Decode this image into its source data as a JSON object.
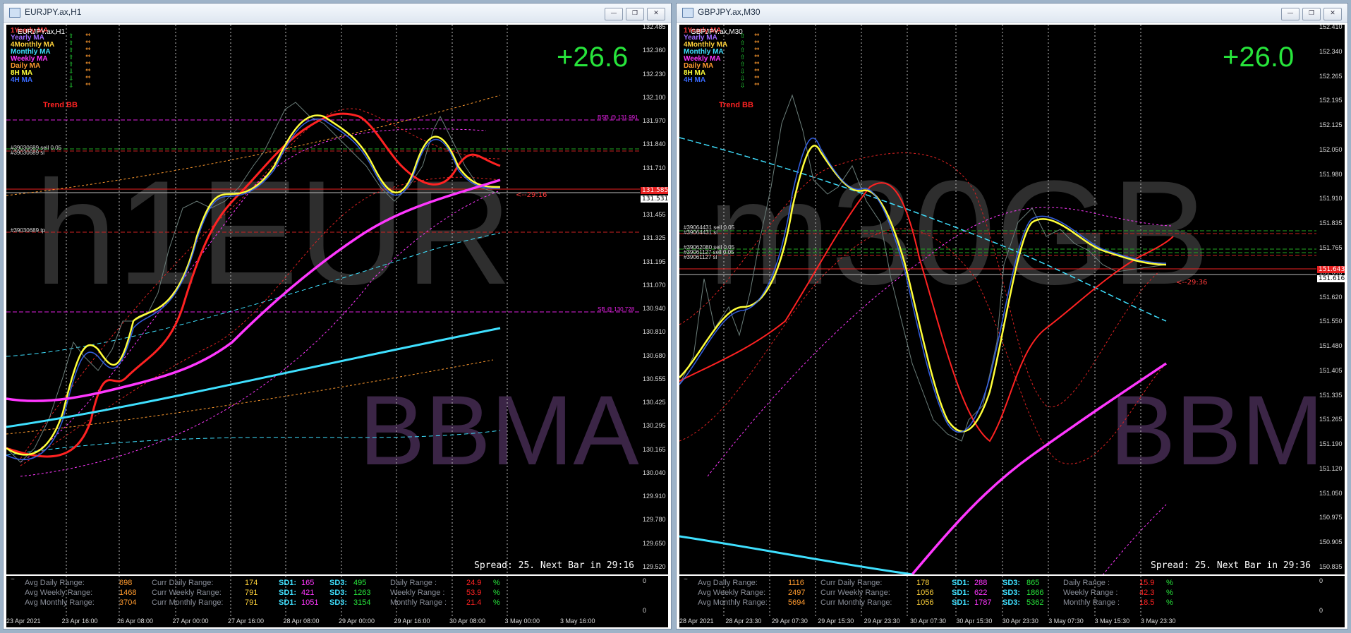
{
  "left": {
    "window_title": "EURJPY.ax,H1",
    "symbol_label": "EURJPY.ax,H1",
    "pips": "+26.6",
    "watermark1": "h1EUR",
    "watermark2": "BBMA",
    "indicators": [
      {
        "label": "1Yearly MA",
        "color": "#ff3d3d"
      },
      {
        "label": "Yearly MA",
        "color": "#a06bff"
      },
      {
        "label": "4Monthly MA",
        "color": "#ffd23a"
      },
      {
        "label": "Monthly MA",
        "color": "#3fe0ff"
      },
      {
        "label": "Weekly MA",
        "color": "#ff37ff"
      },
      {
        "label": "Daily MA",
        "color": "#ff9a2e"
      },
      {
        "label": "8H MA",
        "color": "#ffff3a"
      },
      {
        "label": "4H MA",
        "color": "#3a6bff"
      }
    ],
    "trend": "Trend BB",
    "spread": "Spread: 25. Next Bar in 29:16",
    "timer": "<--29:16",
    "bsb": "BSB @ 131.991",
    "sb": "SB @ 130.728",
    "order1": "#39030689 sell 0.05",
    "order2": "#39030689 sl",
    "order3": "#39030689 tp",
    "price_ticks": [
      "132.485",
      "132.360",
      "132.230",
      "132.100",
      "131.970",
      "131.840",
      "131.710",
      "131.585",
      "131.455",
      "131.325",
      "131.195",
      "131.070",
      "130.940",
      "130.810",
      "130.680",
      "130.555",
      "130.425",
      "130.295",
      "130.165",
      "130.040",
      "129.910",
      "129.780",
      "129.650",
      "129.520"
    ],
    "price_red": "131.585",
    "price_white": "131.531",
    "sub_ticks": [
      "0",
      "0"
    ],
    "x_labels": [
      "23 Apr 2021",
      "23 Apr 16:00",
      "26 Apr 08:00",
      "27 Apr 00:00",
      "27 Apr 16:00",
      "28 Apr 08:00",
      "29 Apr 00:00",
      "29 Apr 16:00",
      "30 Apr 08:00",
      "3 May 00:00",
      "3 May 16:00"
    ],
    "stats": {
      "avg_daily_label": "Avg Daily Range:",
      "avg_daily": "698",
      "avg_weekly_label": "Avg Weekly Range:",
      "avg_weekly": "1468",
      "avg_monthly_label": "Avg Monthly Range:",
      "avg_monthly": "3704",
      "curr_daily_label": "Curr Daily Range:",
      "curr_daily": "174",
      "curr_weekly_label": "Curr Weekly Range:",
      "curr_weekly": "791",
      "curr_monthly_label": "Curr Monthly Range:",
      "curr_monthly": "791",
      "sd1_label": "SD1:",
      "sd1_a": "165",
      "sd1_b": "421",
      "sd1_c": "1051",
      "sd3_label": "SD3:",
      "sd3_a": "495",
      "sd3_b": "1263",
      "sd3_c": "3154",
      "daily_range_label": "Daily Range :",
      "daily_range": "24.9",
      "weekly_range_label": "Weekly Range :",
      "weekly_range": "53.9",
      "monthly_range_label": "Monthly Range :",
      "monthly_range": "21.4",
      "pct": "%"
    }
  },
  "right": {
    "window_title": "GBPJPY.ax,M30",
    "symbol_label": "GBPJPY.ax,M30",
    "pips": "+26.0",
    "watermark1": "m30GB",
    "watermark2": "BBMA",
    "indicators": [
      {
        "label": "1Yearly MA",
        "color": "#ff3d3d"
      },
      {
        "label": "Yearly MA",
        "color": "#a06bff"
      },
      {
        "label": "4Monthly MA",
        "color": "#ffd23a"
      },
      {
        "label": "Monthly MA",
        "color": "#3fe0ff"
      },
      {
        "label": "Weekly MA",
        "color": "#ff37ff"
      },
      {
        "label": "Daily MA",
        "color": "#ff9a2e"
      },
      {
        "label": "8H MA",
        "color": "#ffff3a"
      },
      {
        "label": "4H MA",
        "color": "#3a6bff"
      }
    ],
    "trend": "Trend BB",
    "spread": "Spread: 25. Next Bar in 29:36",
    "timer": "<--29:36",
    "order1": "#39064431 sell 0.05",
    "order2": "#39064431 sl",
    "order3": "#39062080 sell 0.05",
    "order4": "#39061127 sell 0.05",
    "order5": "#39061127 sl",
    "price_ticks": [
      "152.410",
      "152.340",
      "152.265",
      "152.195",
      "152.125",
      "152.050",
      "151.980",
      "151.910",
      "151.835",
      "151.765",
      "151.695",
      "151.620",
      "151.550",
      "151.480",
      "151.405",
      "151.335",
      "151.265",
      "151.190",
      "151.120",
      "151.050",
      "150.975",
      "150.905",
      "150.835"
    ],
    "price_red": "151.643",
    "price_white": "151.616",
    "sub_ticks": [
      "0",
      "0"
    ],
    "x_labels": [
      "28 Apr 2021",
      "28 Apr 23:30",
      "29 Apr 07:30",
      "29 Apr 15:30",
      "29 Apr 23:30",
      "30 Apr 07:30",
      "30 Apr 15:30",
      "30 Apr 23:30",
      "3 May 07:30",
      "3 May 15:30",
      "3 May 23:30"
    ],
    "stats": {
      "avg_daily_label": "Avg Daily Range:",
      "avg_daily": "1116",
      "avg_weekly_label": "Avg Weekly Range:",
      "avg_weekly": "2497",
      "avg_monthly_label": "Avg Monthly Range:",
      "avg_monthly": "5694",
      "curr_daily_label": "Curr Daily Range:",
      "curr_daily": "178",
      "curr_weekly_label": "Curr Weekly Range:",
      "curr_weekly": "1056",
      "curr_monthly_label": "Curr Monthly Range:",
      "curr_monthly": "1056",
      "sd1_label": "SD1:",
      "sd1_a": "288",
      "sd1_b": "622",
      "sd1_c": "1787",
      "sd3_label": "SD3:",
      "sd3_a": "865",
      "sd3_b": "1866",
      "sd3_c": "5362",
      "daily_range_label": "Daily Range :",
      "daily_range": "15.9",
      "weekly_range_label": "Weekly Range :",
      "weekly_range": "42.3",
      "monthly_range_label": "Monthly Range :",
      "monthly_range": "18.5",
      "pct": "%"
    }
  },
  "window_buttons": {
    "minimize": "—",
    "restore": "❐",
    "close": "✕"
  }
}
